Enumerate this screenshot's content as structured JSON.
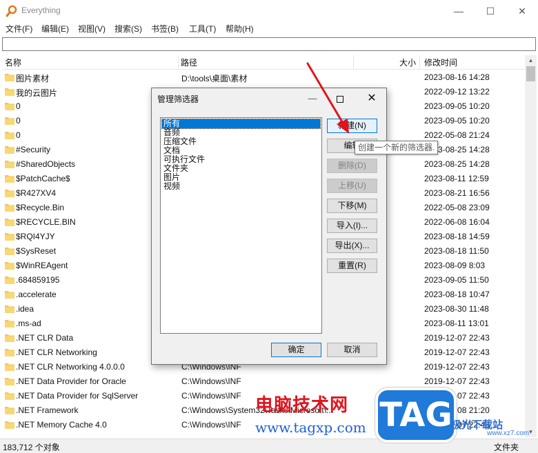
{
  "app": {
    "title": "Everything",
    "controls": {
      "minimize": "—",
      "maximize": "☐",
      "close": "✕"
    }
  },
  "menu": [
    "文件(F)",
    "编辑(E)",
    "视图(V)",
    "搜索(S)",
    "书签(B)",
    "工具(T)",
    "帮助(H)"
  ],
  "search": {
    "value": ""
  },
  "columns": {
    "name": "名称",
    "path": "路径",
    "size": "大小",
    "modified": "修改时间"
  },
  "rows": [
    {
      "name": "图片素材",
      "path": "D:\\tools\\桌面\\素材",
      "modified": "2023-08-16 14:28"
    },
    {
      "name": "我的云图片",
      "path": "",
      "modified": "2022-09-12 13:22"
    },
    {
      "name": "0",
      "path": "",
      "modified": "2023-09-05 10:20"
    },
    {
      "name": "0",
      "path": "",
      "modified": "2023-09-05 10:20"
    },
    {
      "name": "0",
      "path": "",
      "modified": "2022-05-08 21:24"
    },
    {
      "name": "#Security",
      "path": "",
      "modified": "2023-08-25 14:28"
    },
    {
      "name": "#SharedObjects",
      "path": "",
      "modified": "2023-08-25 14:28"
    },
    {
      "name": "$PatchCache$",
      "path": "",
      "modified": "2023-08-11 12:59"
    },
    {
      "name": "$R427XV4",
      "path": "",
      "modified": "2023-08-21 16:56"
    },
    {
      "name": "$Recycle.Bin",
      "path": "",
      "modified": "2022-05-08 23:09"
    },
    {
      "name": "$RECYCLE.BIN",
      "path": "",
      "modified": "2022-06-08 16:04"
    },
    {
      "name": "$RQI4YJY",
      "path": "",
      "modified": "2023-08-18 14:59"
    },
    {
      "name": "$SysReset",
      "path": "",
      "modified": "2023-08-18 11:50"
    },
    {
      "name": "$WinREAgent",
      "path": "",
      "modified": "2023-08-09 8:03"
    },
    {
      "name": ".684859195",
      "path": "",
      "modified": "2023-09-05 11:50"
    },
    {
      "name": ".accelerate",
      "path": "",
      "modified": "2023-08-18 10:47"
    },
    {
      "name": ".idea",
      "path": "",
      "modified": "2023-08-30 11:48"
    },
    {
      "name": ".ms-ad",
      "path": "",
      "modified": "2023-08-11 13:01"
    },
    {
      "name": ".NET CLR Data",
      "path": "",
      "modified": "2019-12-07 22:43"
    },
    {
      "name": ".NET CLR Networking",
      "path": "",
      "modified": "2019-12-07 22:43"
    },
    {
      "name": ".NET CLR Networking 4.0.0.0",
      "path": "C:\\Windows\\INF",
      "modified": "2019-12-07 22:43"
    },
    {
      "name": ".NET Data Provider for Oracle",
      "path": "C:\\Windows\\INF",
      "modified": "2019-12-07 22:43"
    },
    {
      "name": ".NET Data Provider for SqlServer",
      "path": "C:\\Windows\\INF",
      "modified": "2019-12-07 22:43"
    },
    {
      "name": ".NET Framework",
      "path": "C:\\Windows\\System32\\Tasks\\Microsoft\\...",
      "modified": "2022-05-08 21:20"
    },
    {
      "name": ".NET Memory Cache 4.0",
      "path": "C:\\Windows\\INF",
      "modified": "2019-12-07 22:43"
    }
  ],
  "status": {
    "count": "183,712 个对象",
    "type": "文件夹"
  },
  "dialog": {
    "title": "管理筛选器",
    "filters": [
      "所有",
      "音频",
      "压缩文件",
      "文档",
      "可执行文件",
      "文件夹",
      "图片",
      "视频"
    ],
    "buttons": {
      "new": "新建(N)",
      "edit": "编辑",
      "delete": "删除(D)",
      "move_up": "上移(U)",
      "move_down": "下移(M)",
      "import": "导入(I)...",
      "export": "导出(X)...",
      "reset": "重置(R)",
      "ok": "确定",
      "cancel": "取消"
    },
    "tooltip": "创建一个新的筛选器."
  },
  "watermark": {
    "brand": "电脑技术网",
    "url": "www.tagxp.com",
    "badge": "TAG",
    "site": "极光下载站",
    "site_url": "www.xz7.com"
  },
  "colors": {
    "selection": "#0078d7",
    "folder": "#f3c75c",
    "annotation_arrow": "#e0141e"
  }
}
